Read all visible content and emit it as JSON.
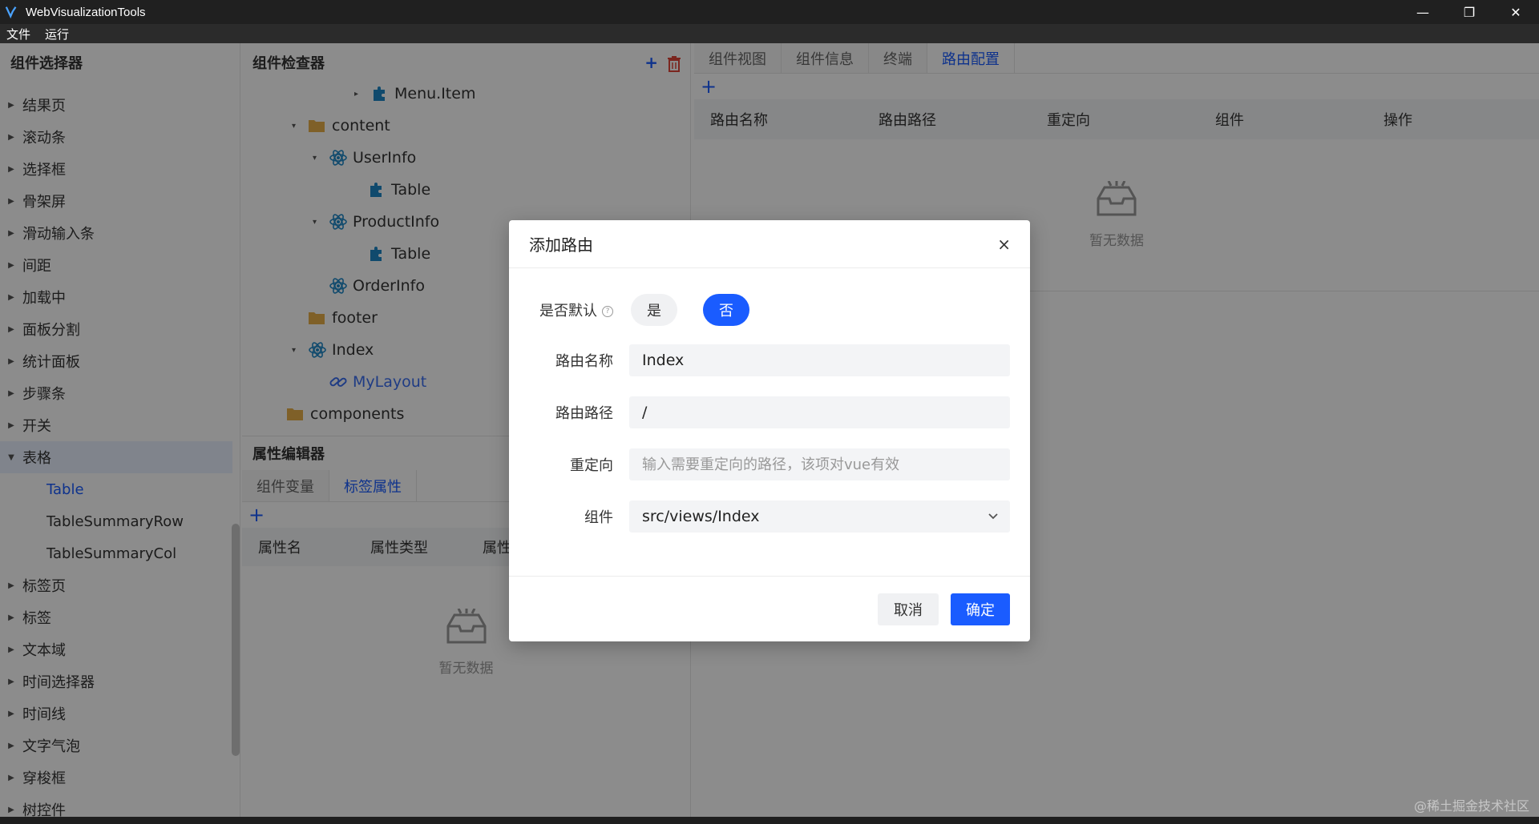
{
  "window": {
    "title": "WebVisualizationTools",
    "minimize": "—",
    "restore": "❐",
    "close": "✕"
  },
  "menu": [
    "文件",
    "运行"
  ],
  "sidebar": {
    "title": "组件选择器",
    "items": [
      "结果页",
      "滚动条",
      "选择框",
      "骨架屏",
      "滑动输入条",
      "间距",
      "加载中",
      "面板分割",
      "统计面板",
      "步骤条",
      "开关",
      "表格"
    ],
    "table_children": [
      "Table",
      "TableSummaryRow",
      "TableSummaryCol"
    ],
    "items_after": [
      "标签页",
      "标签",
      "文本域",
      "时间选择器",
      "时间线",
      "文字气泡",
      "穿梭框",
      "树控件"
    ]
  },
  "inspector": {
    "title": "组件检查器",
    "add": "+",
    "delete": "🗑",
    "tree": [
      {
        "label": "Menu.Item",
        "indent": 0,
        "icon": "puzzle",
        "caret": "▸"
      },
      {
        "label": "content",
        "indent": 1,
        "icon": "folder",
        "caret": "▾"
      },
      {
        "label": "UserInfo",
        "indent": 2,
        "icon": "react",
        "caret": "▾"
      },
      {
        "label": "Table",
        "indent": 3,
        "icon": "puzzle",
        "caret": ""
      },
      {
        "label": "ProductInfo",
        "indent": 2,
        "icon": "react",
        "caret": "▾"
      },
      {
        "label": "Table",
        "indent": 3,
        "icon": "puzzle",
        "caret": ""
      },
      {
        "label": "OrderInfo",
        "indent": 2,
        "icon": "react",
        "caret": ""
      },
      {
        "label": "footer",
        "indent": 1,
        "icon": "folder",
        "caret": ""
      },
      {
        "label": "Index",
        "indent": 1,
        "icon": "react",
        "caret": "▾"
      },
      {
        "label": "MyLayout",
        "indent": 2,
        "icon": "link",
        "caret": ""
      },
      {
        "label": "components",
        "indent": 0,
        "icon": "folder",
        "caret": ""
      }
    ]
  },
  "props": {
    "title": "属性编辑器",
    "tabs": [
      "组件变量",
      "标签属性"
    ],
    "add": "+",
    "columns": [
      "属性名",
      "属性类型",
      "属性"
    ],
    "empty": "暂无数据"
  },
  "right": {
    "tabs": [
      "组件视图",
      "组件信息",
      "终端",
      "路由配置"
    ],
    "add": "+",
    "columns": [
      "路由名称",
      "路由路径",
      "重定向",
      "组件",
      "操作"
    ],
    "empty": "暂无数据"
  },
  "dialog": {
    "title": "添加路由",
    "close": "×",
    "default_label": "是否默认",
    "hint": "?",
    "opt_yes": "是",
    "opt_no": "否",
    "name_label": "路由名称",
    "name_value": "Index",
    "path_label": "路由路径",
    "path_value": "/",
    "redirect_label": "重定向",
    "redirect_placeholder": "输入需要重定向的路径，该项对vue有效",
    "component_label": "组件",
    "component_value": "src/views/Index",
    "cancel": "取消",
    "ok": "确定"
  },
  "watermark": "@稀土掘金技术社区",
  "colors": {
    "primary": "#1a5cff",
    "react": "#1e88c7"
  }
}
